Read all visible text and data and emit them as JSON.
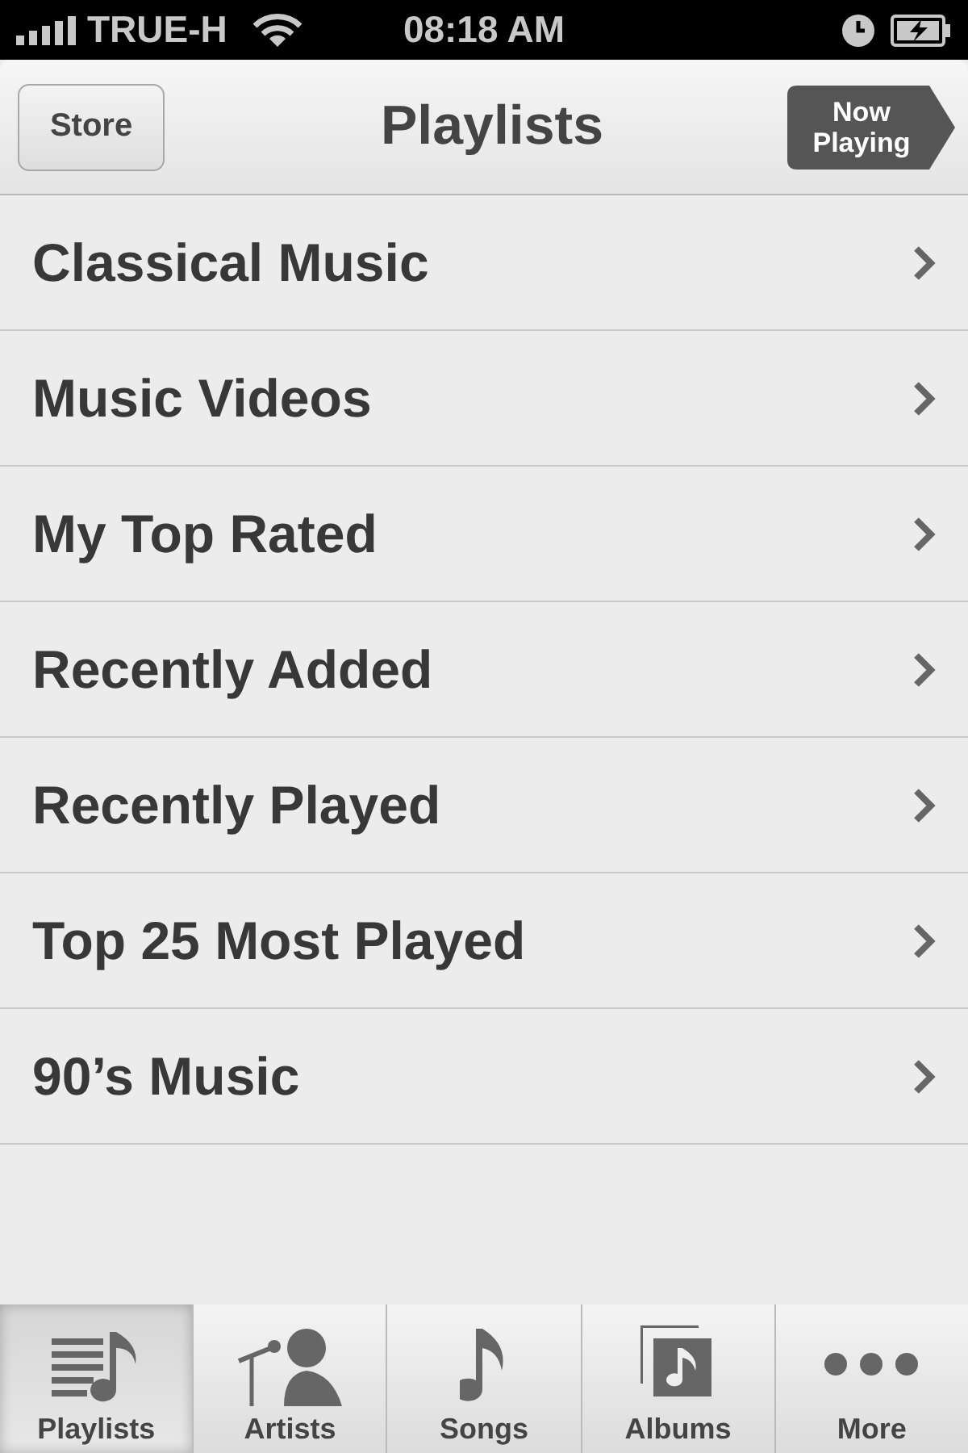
{
  "status_bar": {
    "carrier": "TRUE-H",
    "time": "08:18 AM"
  },
  "nav_bar": {
    "left_button": "Store",
    "title": "Playlists",
    "right_button": "Now Playing"
  },
  "playlists": [
    {
      "label": "Classical Music"
    },
    {
      "label": "Music Videos"
    },
    {
      "label": "My Top Rated"
    },
    {
      "label": "Recently Added"
    },
    {
      "label": "Recently Played"
    },
    {
      "label": "Top 25 Most Played"
    },
    {
      "label": "90’s Music"
    }
  ],
  "tabs": [
    {
      "label": "Playlists",
      "kind": "playlists",
      "selected": true
    },
    {
      "label": "Artists",
      "kind": "artists",
      "selected": false
    },
    {
      "label": "Songs",
      "kind": "songs",
      "selected": false
    },
    {
      "label": "Albums",
      "kind": "albums",
      "selected": false
    },
    {
      "label": "More",
      "kind": "more",
      "selected": false
    }
  ]
}
